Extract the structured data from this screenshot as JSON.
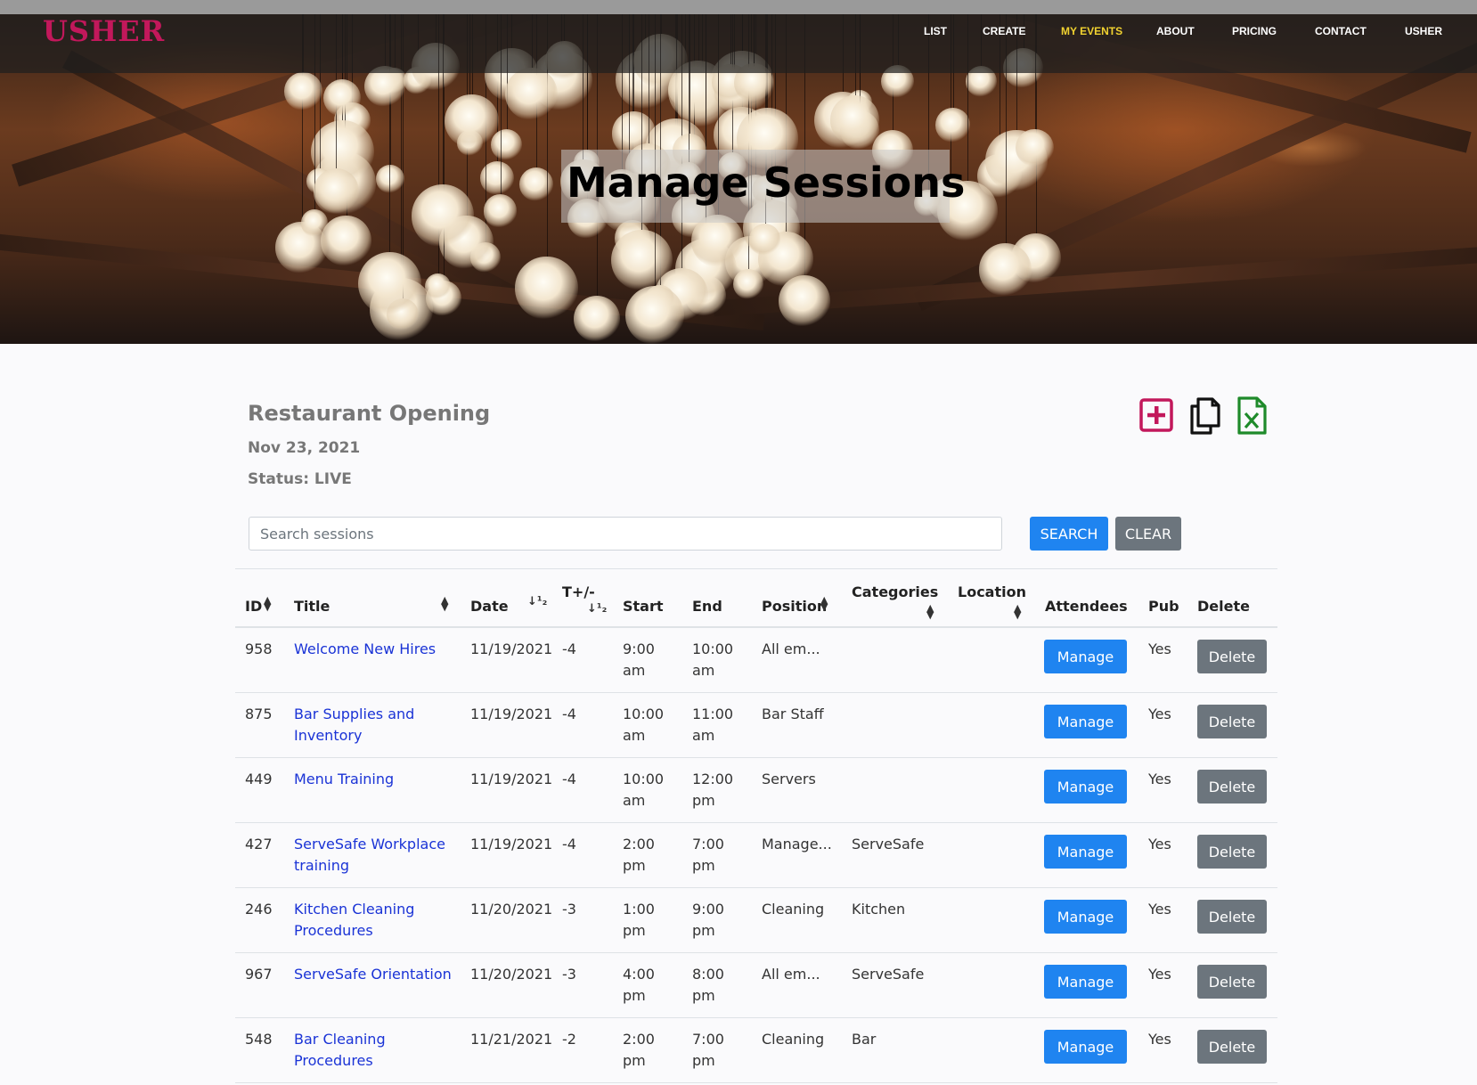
{
  "nav": {
    "logo": "USHER",
    "items": [
      {
        "label": "LIST",
        "active": false
      },
      {
        "label": "CREATE",
        "active": false
      },
      {
        "label": "MY EVENTS",
        "active": true
      },
      {
        "label": "ABOUT",
        "active": false
      },
      {
        "label": "PRICING",
        "active": false
      },
      {
        "label": "CONTACT",
        "active": false
      },
      {
        "label": "USHER",
        "active": false
      }
    ]
  },
  "hero": {
    "title": "Manage Sessions"
  },
  "event": {
    "title": "Restaurant Opening",
    "date": "Nov 23, 2021",
    "status": "Status: LIVE"
  },
  "tools": [
    {
      "icon": "plus-square-icon",
      "color": "#c2185b"
    },
    {
      "icon": "copy-icon",
      "color": "#111111"
    },
    {
      "icon": "excel-file-icon",
      "color": "#1e8a2a"
    }
  ],
  "search": {
    "placeholder": "Search sessions",
    "value": "",
    "search_label": "SEARCH",
    "clear_label": "CLEAR"
  },
  "table": {
    "headers": {
      "id": "ID",
      "title": "Title",
      "date": "Date",
      "tpm": "T+/-",
      "start": "Start",
      "end": "End",
      "position": "Position",
      "categories": "Categories",
      "location": "Location",
      "attendees": "Attendees",
      "pub": "Pub",
      "delete": "Delete"
    },
    "manage_label": "Manage",
    "delete_label": "Delete",
    "rows": [
      {
        "id": "958",
        "title1": "Welcome New Hires",
        "title2": "",
        "date": "11/19/2021",
        "tpm": "-4",
        "start1": "9:00",
        "start2": "am",
        "end1": "10:00",
        "end2": "am",
        "position": "All em...",
        "categories": "",
        "location": "",
        "pub": "Yes"
      },
      {
        "id": "875",
        "title1": "Bar Supplies and",
        "title2": "Inventory",
        "date": "11/19/2021",
        "tpm": "-4",
        "start1": "10:00",
        "start2": "am",
        "end1": "11:00",
        "end2": "am",
        "position": "Bar Staff",
        "categories": "",
        "location": "",
        "pub": "Yes"
      },
      {
        "id": "449",
        "title1": "Menu Training",
        "title2": "",
        "date": "11/19/2021",
        "tpm": "-4",
        "start1": "10:00",
        "start2": "am",
        "end1": "12:00",
        "end2": "pm",
        "position": "Servers",
        "categories": "",
        "location": "",
        "pub": "Yes"
      },
      {
        "id": "427",
        "title1": "ServeSafe Workplace",
        "title2": "training",
        "date": "11/19/2021",
        "tpm": "-4",
        "start1": "2:00",
        "start2": "pm",
        "end1": "7:00",
        "end2": "pm",
        "position": "Manage...",
        "categories": "ServeSafe",
        "location": "",
        "pub": "Yes"
      },
      {
        "id": "246",
        "title1": "Kitchen Cleaning",
        "title2": "Procedures",
        "date": "11/20/2021",
        "tpm": "-3",
        "start1": "1:00",
        "start2": "pm",
        "end1": "9:00",
        "end2": "pm",
        "position": "Cleaning",
        "categories": "Kitchen",
        "location": "",
        "pub": "Yes"
      },
      {
        "id": "967",
        "title1": "ServeSafe Orientation",
        "title2": "",
        "date": "11/20/2021",
        "tpm": "-3",
        "start1": "4:00",
        "start2": "pm",
        "end1": "8:00",
        "end2": "pm",
        "position": "All em...",
        "categories": "ServeSafe",
        "location": "",
        "pub": "Yes"
      },
      {
        "id": "548",
        "title1": "Bar Cleaning",
        "title2": "Procedures",
        "date": "11/21/2021",
        "tpm": "-2",
        "start1": "2:00",
        "start2": "pm",
        "end1": "7:00",
        "end2": "pm",
        "position": "Cleaning",
        "categories": "Bar",
        "location": "",
        "pub": "Yes"
      }
    ]
  }
}
